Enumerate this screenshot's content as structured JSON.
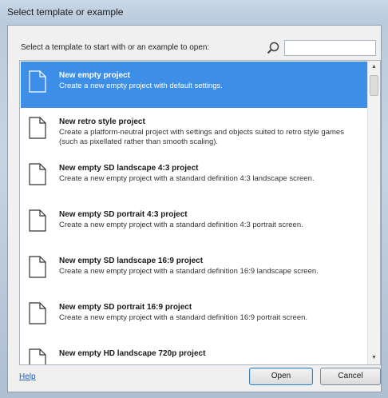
{
  "window": {
    "title": "Select template or example"
  },
  "instruction": "Select a template to start with or an example to open:",
  "search": {
    "value": "",
    "placeholder": ""
  },
  "items": [
    {
      "title": "New empty project",
      "description": "Create a new empty project with default settings.",
      "selected": true
    },
    {
      "title": "New retro style project",
      "description": "Create a platform-neutral project with settings and objects suited to retro style games (such as pixellated rather than smooth scaling).",
      "selected": false
    },
    {
      "title": "New empty SD landscape 4:3 project",
      "description": "Create a new empty project with a standard definition 4:3 landscape screen.",
      "selected": false
    },
    {
      "title": "New empty SD portrait 4:3 project",
      "description": "Create a new empty project with a standard definition 4:3 portrait screen.",
      "selected": false
    },
    {
      "title": "New empty SD landscape 16:9 project",
      "description": "Create a new empty project with a standard definition 16:9 landscape screen.",
      "selected": false
    },
    {
      "title": "New empty SD portrait 16:9 project",
      "description": "Create a new empty project with a standard definition 16:9 portrait screen.",
      "selected": false
    },
    {
      "title": "New empty HD landscape 720p project",
      "description": "",
      "selected": false
    }
  ],
  "footer": {
    "help_label": "Help",
    "open_label": "Open",
    "cancel_label": "Cancel"
  },
  "colors": {
    "selection": "#3d8ee6",
    "link": "#1d5fbf"
  },
  "icons": {
    "search": "magnifier-icon",
    "item": "document-icon"
  }
}
